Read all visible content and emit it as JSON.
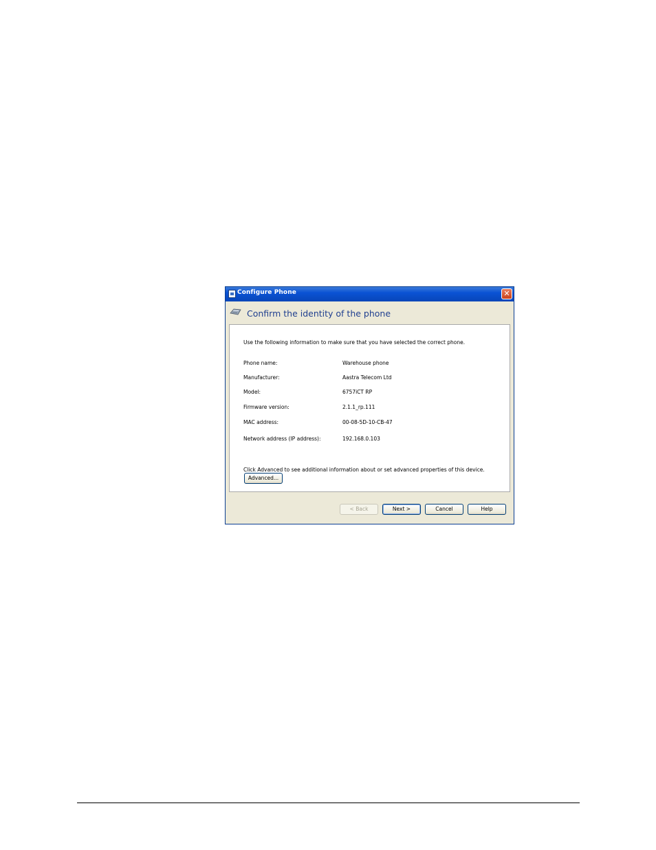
{
  "window": {
    "title": "Configure Phone",
    "close_glyph": "✕"
  },
  "header": {
    "title": "Confirm the identity of the phone",
    "icon": "phone-icon"
  },
  "intro": "Use the following information to make sure that you have selected the correct phone.",
  "rows": [
    {
      "label": "Phone name:",
      "value": "Warehouse phone"
    },
    {
      "label": "Manufacturer:",
      "value": "Aastra Telecom Ltd"
    },
    {
      "label": "Model:",
      "value": "6757iCT RP"
    },
    {
      "label": "Firmware version:",
      "value": "2.1.1_rp.111"
    },
    {
      "label": "MAC address:",
      "value": "00-08-5D-10-CB-47"
    },
    {
      "label": "Network address (IP address):",
      "value": "192.168.0.103"
    }
  ],
  "advanced": {
    "text": "Click Advanced to see additional information about or set advanced properties of this device.",
    "button_label": "Advanced..."
  },
  "buttons": {
    "back": "< Back",
    "next": "Next >",
    "cancel": "Cancel",
    "help": "Help"
  },
  "colors": {
    "titlebar": "#0a52d4",
    "header_title": "#1f3f8f",
    "dialog_bg": "#ece9d8"
  }
}
